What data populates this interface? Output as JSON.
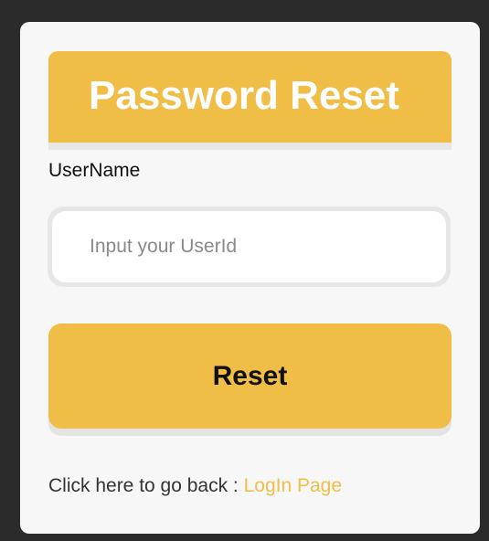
{
  "header": {
    "title": "Password Reset"
  },
  "form": {
    "username_label": "UserName",
    "userid_placeholder": "Input your UserId",
    "userid_value": "",
    "reset_label": "Reset"
  },
  "footer": {
    "back_text": "Click here to go back : ",
    "login_link_label": "LogIn Page"
  },
  "colors": {
    "background": "#2b2b2b",
    "card": "#f7f7f7",
    "accent": "#f0bd47",
    "header_text": "#ffffff",
    "link": "#f0bd47"
  }
}
